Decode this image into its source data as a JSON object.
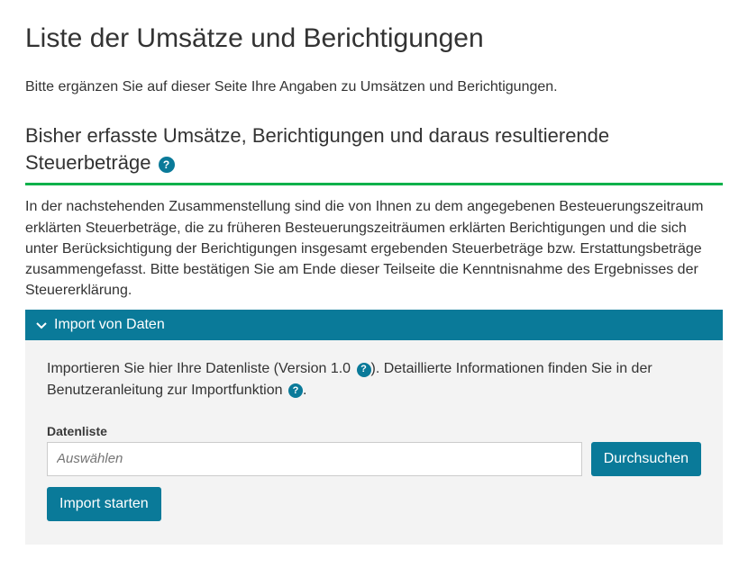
{
  "page": {
    "title": "Liste der Umsätze und Berichtigungen",
    "intro": "Bitte ergänzen Sie auf dieser Seite Ihre Angaben zu Umsätzen und Berichtigungen."
  },
  "section": {
    "heading": "Bisher erfasste Umsätze, Berichtigungen und daraus resultierende Steuerbeträge",
    "help_glyph": "?",
    "summary": "In der nachstehenden Zusammenstellung sind die von Ihnen zu dem angegebenen Besteuerungszeitraum erklärten Steuerbeträge, die zu früheren Besteuerungszeiträumen erklärten Berichtigungen und die sich unter Berücksichtigung der Berichtigungen insgesamt ergebenden Steuerbeträge bzw. Erstattungsbeträge zusammengefasst. Bitte bestätigen Sie am Ende dieser Teilseite die Kenntnisnahme des Ergebnisses der Steuererklärung."
  },
  "import_panel": {
    "title": "Import von Daten",
    "desc_pre": "Importieren Sie hier Ihre Datenliste (Version 1.0 ",
    "desc_mid": "). Detaillierte Informationen finden Sie in der Benutzeranleitung zur Importfunktion ",
    "desc_post": ".",
    "help_glyph": "?",
    "field_label": "Datenliste",
    "placeholder": "Auswählen",
    "browse_label": "Durchsuchen",
    "start_label": "Import starten"
  }
}
